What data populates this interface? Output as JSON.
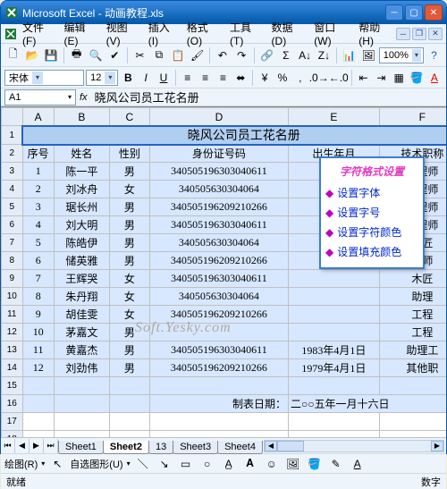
{
  "window": {
    "app": "Microsoft Excel",
    "doc": "动画教程.xls"
  },
  "menu": [
    "文件(F)",
    "编辑(E)",
    "视图(V)",
    "插入(I)",
    "格式(O)",
    "工具(T)",
    "数据(D)",
    "窗口(W)",
    "帮助(H)"
  ],
  "font": {
    "name": "宋体",
    "size": "12"
  },
  "zoom": "100%",
  "namebox": "A1",
  "formula": "晓风公司员工花名册",
  "sheet": {
    "cols": [
      "A",
      "B",
      "C",
      "D",
      "E",
      "F"
    ],
    "title": "晓风公司员工花名册",
    "headers": [
      "序号",
      "姓名",
      "性别",
      "身份证号码",
      "出生年月",
      "技术职称"
    ],
    "rows": [
      {
        "n": "1",
        "name": "陈一平",
        "sex": "男",
        "id": "340505196303040611",
        "e": "",
        "f": "工程师"
      },
      {
        "n": "2",
        "name": "刘冰舟",
        "sex": "女",
        "id": "340505630304064",
        "e": "",
        "f": "工程师"
      },
      {
        "n": "3",
        "name": "琚长州",
        "sex": "男",
        "id": "340505196209210266",
        "e": "",
        "f": "工程师"
      },
      {
        "n": "4",
        "name": "刘大明",
        "sex": "男",
        "id": "340505196303040611",
        "e": "",
        "f": "工程师"
      },
      {
        "n": "5",
        "name": "陈皓伊",
        "sex": "男",
        "id": "340505630304064",
        "e": "",
        "f": "木匠"
      },
      {
        "n": "6",
        "name": "储英雅",
        "sex": "男",
        "id": "340505196209210266",
        "e": "",
        "f": "程师"
      },
      {
        "n": "7",
        "name": "王辉哭",
        "sex": "女",
        "id": "340505196303040611",
        "e": "",
        "f": "木匠"
      },
      {
        "n": "8",
        "name": "朱丹翔",
        "sex": "女",
        "id": "340505630304064",
        "e": "",
        "f": "助理"
      },
      {
        "n": "9",
        "name": "胡佳雯",
        "sex": "女",
        "id": "340505196209210266",
        "e": "",
        "f": "工程"
      },
      {
        "n": "10",
        "name": "茅嘉文",
        "sex": "男",
        "id": "",
        "e": "",
        "f": "工程"
      },
      {
        "n": "11",
        "name": "黄嘉杰",
        "sex": "男",
        "id": "340505196303040611",
        "e": "1983年4月1日",
        "f": "助理工"
      },
      {
        "n": "12",
        "name": "刘劲伟",
        "sex": "男",
        "id": "340505196209210266",
        "e": "1979年4月1日",
        "f": "其他职"
      }
    ],
    "footer_label": "制表日期：",
    "footer_date": "二○○五年一月十六日"
  },
  "popup": {
    "title": "字符格式设置",
    "items": [
      "设置字体",
      "设置字号",
      "设置字符颜色",
      "设置填充颜色"
    ]
  },
  "watermark": "Soft.Yesky.com",
  "tabs": [
    "Sheet1",
    "Sheet2",
    "13",
    "Sheet3",
    "Sheet4"
  ],
  "draw": {
    "menu": "绘图(R)",
    "autoshape": "自选图形(U)"
  },
  "status": {
    "left": "就绪",
    "right": "数字"
  }
}
